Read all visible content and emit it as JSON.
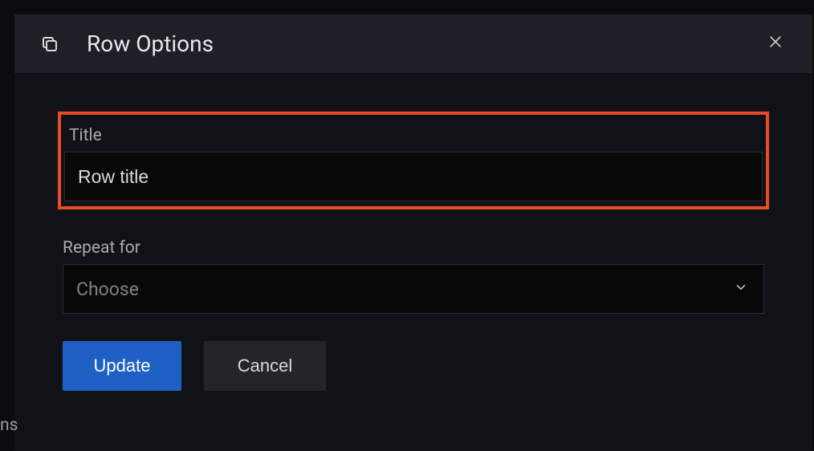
{
  "dialog": {
    "title": "Row Options"
  },
  "fields": {
    "title": {
      "label": "Title",
      "value": "Row title"
    },
    "repeat": {
      "label": "Repeat for",
      "placeholder": "Choose"
    }
  },
  "buttons": {
    "update": "Update",
    "cancel": "Cancel"
  },
  "fragments": {
    "ns": "ns"
  }
}
